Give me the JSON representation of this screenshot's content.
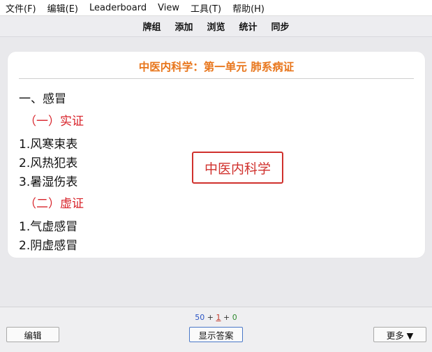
{
  "menubar": {
    "items": [
      "文件(F)",
      "编辑(E)",
      "Leaderboard",
      "View",
      "工具(T)",
      "帮助(H)"
    ]
  },
  "toolbar": {
    "items": [
      "牌组",
      "添加",
      "浏览",
      "统计",
      "同步"
    ]
  },
  "card": {
    "title": "中医内科学：第一单元 肺系病证",
    "lines": {
      "l0": "一、感冒",
      "l1": "（一）实证",
      "l2": "1.风寒束表",
      "l3": "2.风热犯表",
      "l4": "3.暑湿伤表",
      "l5": "（二）虚证",
      "l6": "1.气虚感冒",
      "l7": "2.阴虚感冒"
    },
    "stamp": "中医内科学"
  },
  "bottom": {
    "new_count": "50",
    "learn_count": "1",
    "review_count": "0",
    "plus": "+",
    "edit_label": "编辑",
    "show_answer_label": "显示答案",
    "more_label": "更多 ▼"
  },
  "colors": {
    "title": "#e8761c",
    "red_heading": "#d8232a",
    "stamp": "#d0312d",
    "new": "#2a54c4",
    "learn": "#c0392b",
    "review": "#2f8a2f"
  }
}
